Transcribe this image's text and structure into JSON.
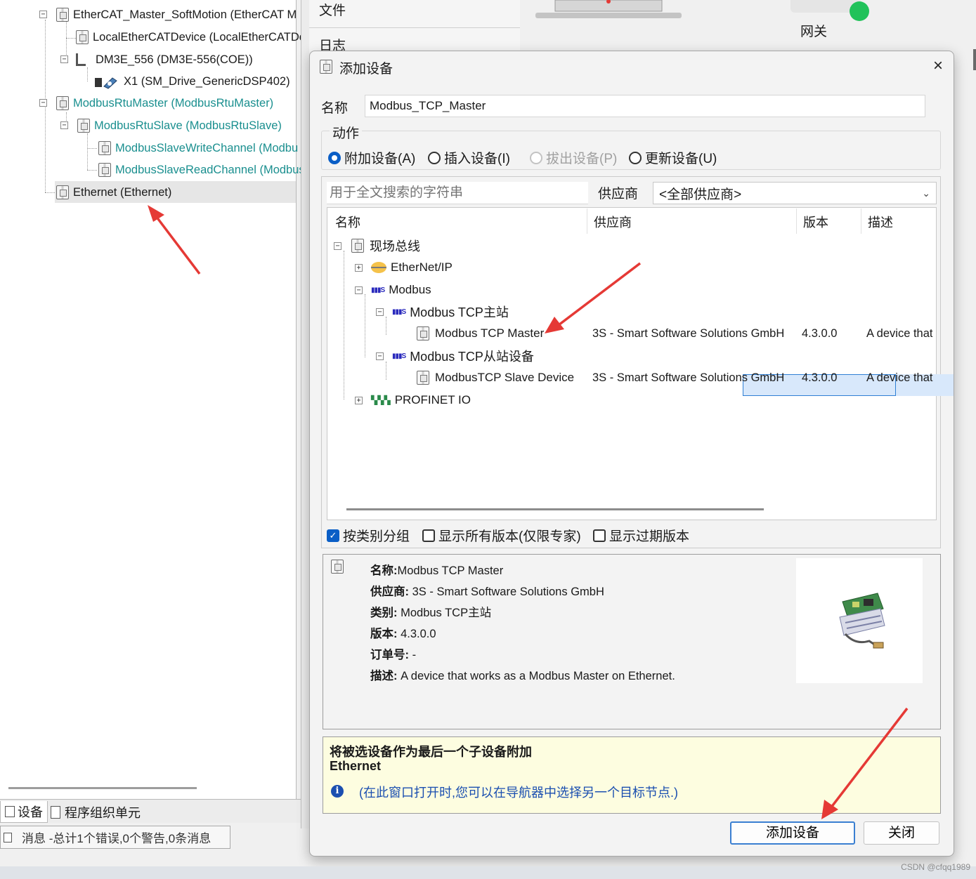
{
  "colors": {
    "accent": "#0a5ec6",
    "teal_text": "#1a8f8f",
    "hint_bg": "#fdfde0",
    "hint_text": "#1b4fb0",
    "gateway_led": "#21c25a",
    "annotation_arrow": "#e53935"
  },
  "project_tree": [
    {
      "label": "EtherCAT_Master_SoftMotion (EtherCAT M",
      "icon": "device-icon"
    },
    {
      "label": "LocalEtherCATDevice (LocalEtherCATDe",
      "icon": "device-icon"
    },
    {
      "label": "DM3E_556 (DM3E-556(COE))",
      "icon": "drive-icon"
    },
    {
      "label": "X1 (SM_Drive_GenericDSP402)",
      "icon": "axis-icon"
    },
    {
      "label": "ModbusRtuMaster (ModbusRtuMaster)",
      "icon": "device-icon"
    },
    {
      "label": "ModbusRtuSlave (ModbusRtuSlave)",
      "icon": "device-icon"
    },
    {
      "label": "ModbusSlaveWriteChannel (Modbu",
      "icon": "device-icon"
    },
    {
      "label": "ModbusSlaveReadChannel (Modbus",
      "icon": "device-icon"
    },
    {
      "label": "Ethernet (Ethernet)",
      "icon": "device-icon"
    }
  ],
  "bottom_tabs": {
    "devices": "设备",
    "pou": "程序组织单元"
  },
  "messages": "消息 -总计1个错误,0个警告,0条消息",
  "mid_pane": {
    "file": "文件",
    "log": "日志"
  },
  "gateway_label": "网关",
  "watermark": "CSDN @cfqq1989",
  "dialog": {
    "title": "添加设备",
    "close": "×",
    "name_label": "名称",
    "name_value": "Modbus_TCP_Master",
    "action_label": "动作",
    "actions": {
      "append": "附加设备(A)",
      "insert": "插入设备(I)",
      "plug": "拔出设备(P)",
      "update": "更新设备(U)"
    },
    "search_placeholder": "用于全文搜索的字符串",
    "vendor_label": "供应商",
    "vendor_value": "<全部供应商>",
    "columns": {
      "name": "名称",
      "vendor": "供应商",
      "version": "版本",
      "desc": "描述"
    },
    "tree": {
      "fieldbus": "现场总线",
      "ethernetip": "EtherNet/IP",
      "modbus": "Modbus",
      "tcp_master_group": "Modbus TCP主站",
      "tcp_master": {
        "name": "Modbus TCP Master",
        "vendor": "3S - Smart Software Solutions GmbH",
        "version": "4.3.0.0",
        "desc": "A device that"
      },
      "tcp_slave_group": "Modbus TCP从站设备",
      "tcp_slave": {
        "name": "ModbusTCP Slave Device",
        "vendor": "3S - Smart Software Solutions GmbH",
        "version": "4.3.0.0",
        "desc": "A device that"
      },
      "profinet": "PROFINET IO"
    },
    "options": {
      "group_by_category": "按类别分组",
      "show_all_versions": "显示所有版本(仅限专家)",
      "show_outdated": "显示过期版本"
    },
    "info": {
      "name_key": "名称:",
      "name_val": "Modbus TCP Master",
      "vendor_key": "供应商:",
      "vendor_val": "3S - Smart Software Solutions GmbH",
      "category_key": "类别:",
      "category_val": "Modbus TCP主站",
      "version_key": "版本:",
      "version_val": "4.3.0.0",
      "order_key": "订单号:",
      "order_val": "-",
      "desc_key": "描述:",
      "desc_val": "A device that works as a Modbus Master on Ethernet."
    },
    "hint": {
      "title": "将被选设备作为最后一个子设备附加",
      "target": "Ethernet",
      "note": "(在此窗口打开时,您可以在导航器中选择另一个目标节点.)"
    },
    "buttons": {
      "add": "添加设备",
      "close": "关闭"
    }
  }
}
